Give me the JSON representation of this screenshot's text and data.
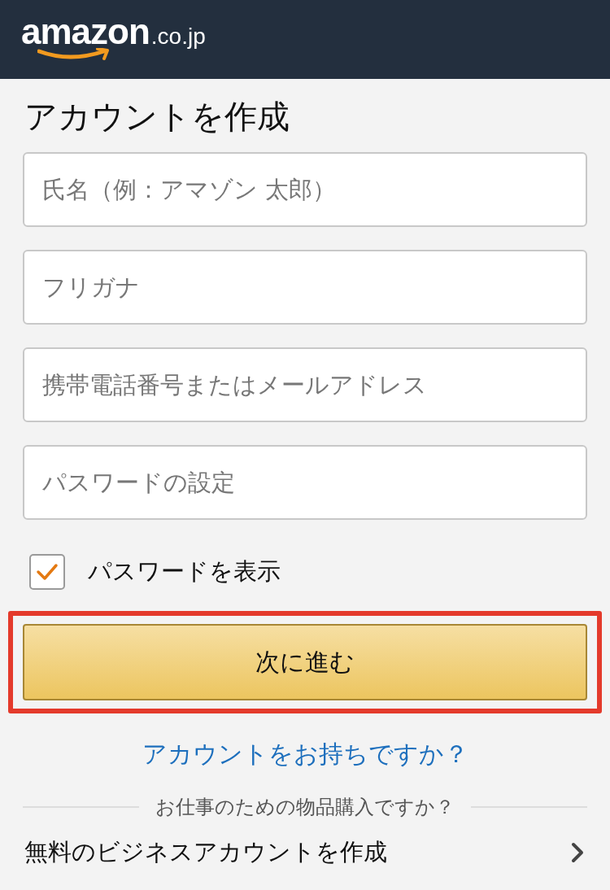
{
  "header": {
    "logo": "amazon",
    "logo_suffix": ".co.jp"
  },
  "title": "アカウントを作成",
  "fields": [
    {
      "placeholder": "氏名（例：アマゾン 太郎）"
    },
    {
      "placeholder": "フリガナ"
    },
    {
      "placeholder": "携帯電話番号またはメールアドレス"
    },
    {
      "placeholder": "パスワードの設定"
    }
  ],
  "show_password": {
    "label": "パスワードを表示",
    "checked": true
  },
  "submit": {
    "label": "次に進む",
    "highlighted": true
  },
  "signin_link": "アカウントをお持ちですか？",
  "business": {
    "divider_text": "お仕事のための物品購入ですか？",
    "link": "無料のビジネスアカウントを作成"
  }
}
